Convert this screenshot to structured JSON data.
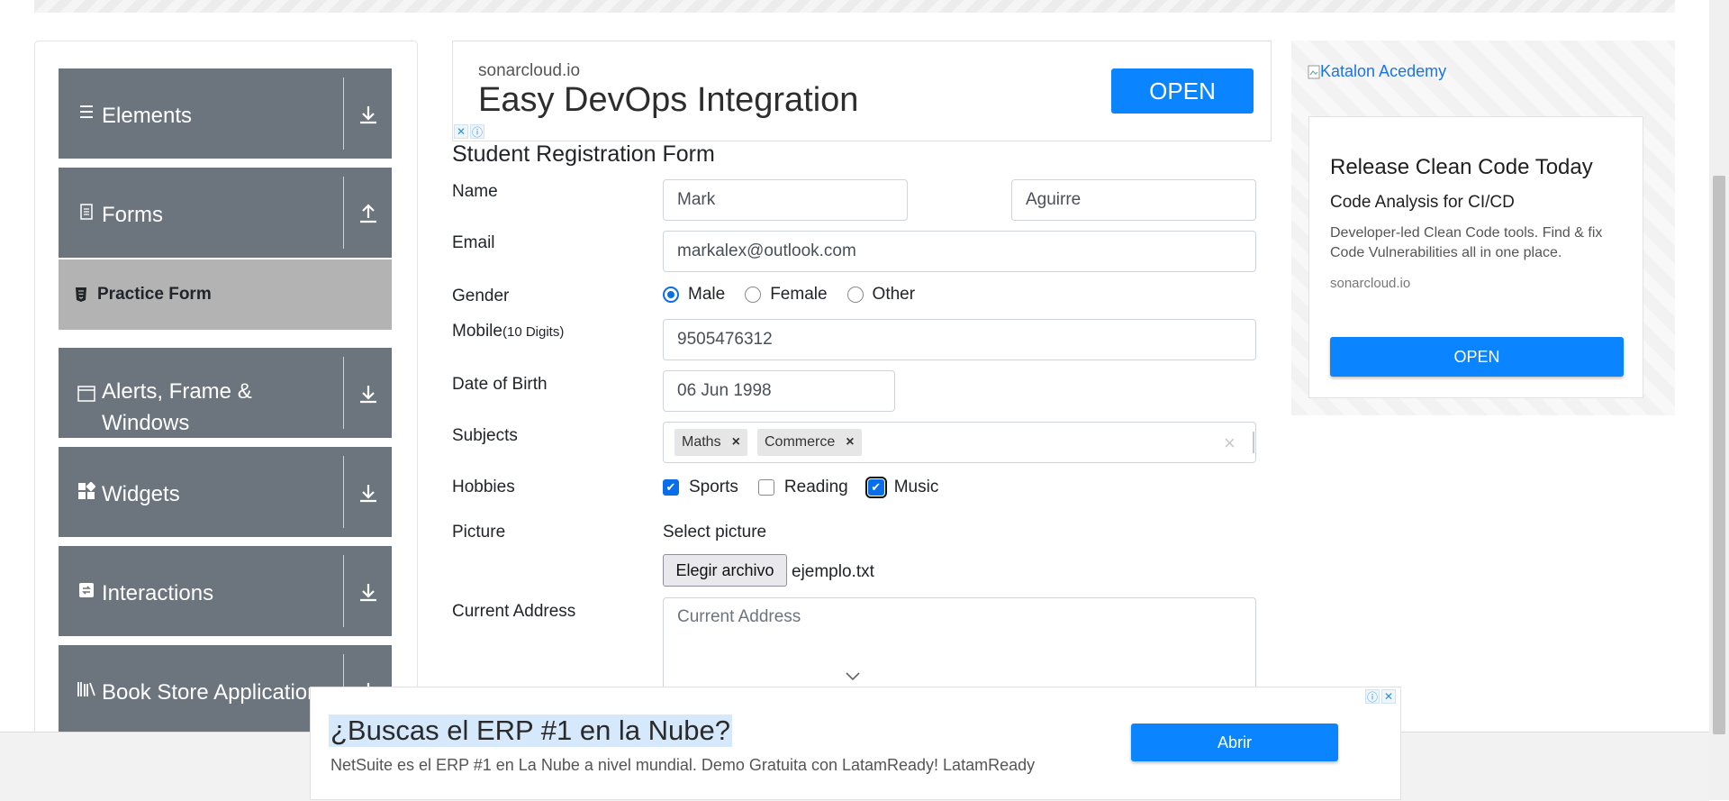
{
  "sidebar": {
    "groups": [
      {
        "label": "Elements",
        "icon": "menu-icon",
        "arrow": "down"
      },
      {
        "label": "Forms",
        "icon": "document-icon",
        "arrow": "up"
      },
      {
        "label": "Alerts, Frame &",
        "label_line2": "Windows",
        "icon": "window-icon",
        "arrow": "down"
      },
      {
        "label": "Widgets",
        "icon": "widgets-icon",
        "arrow": "down"
      },
      {
        "label": "Interactions",
        "icon": "interactions-icon",
        "arrow": "down"
      },
      {
        "label": "Book Store Application",
        "icon": "bookshelf-icon",
        "arrow": "down"
      }
    ],
    "active_item": "Practice Form"
  },
  "ad_top": {
    "source": "sonarcloud.io",
    "headline": "Easy DevOps Integration",
    "button": "OPEN"
  },
  "form": {
    "title": "Student Registration Form",
    "name_label": "Name",
    "first_name": "Mark",
    "last_name": "Aguirre",
    "email_label": "Email",
    "email": "markalex@outlook.com",
    "gender_label": "Gender",
    "gender_options": [
      "Male",
      "Female",
      "Other"
    ],
    "gender_selected": "Male",
    "mobile_label": "Mobile",
    "mobile_hint": "(10 Digits)",
    "mobile": "9505476312",
    "dob_label": "Date of Birth",
    "dob": "06 Jun 1998",
    "subjects_label": "Subjects",
    "subjects": [
      "Maths",
      "Commerce"
    ],
    "hobbies_label": "Hobbies",
    "hobbies": [
      {
        "label": "Sports",
        "checked": true
      },
      {
        "label": "Reading",
        "checked": false
      },
      {
        "label": "Music",
        "checked": true
      }
    ],
    "picture_label": "Picture",
    "select_picture": "Select picture",
    "file_button": "Elegir archivo",
    "file_name": "ejemplo.txt",
    "address_label": "Current Address",
    "address_placeholder": "Current Address"
  },
  "ad_right": {
    "image_alt": "Katalon Acedemy",
    "headline": "Release Clean Code Today",
    "subheadline": "Code Analysis for CI/CD",
    "description": "Developer-led Clean Code tools. Find & fix Code Vulnerabilities all in one place.",
    "domain": "sonarcloud.io",
    "button": "OPEN"
  },
  "ad_bottom": {
    "headline": "¿Buscas el ERP #1 en la Nube?",
    "description": "NetSuite es el ERP #1 en La Nube a nivel mundial. Demo Gratuita con LatamReady! LatamReady",
    "button": "Abrir"
  },
  "colors": {
    "sidebar_group": "#6c757d",
    "active_item": "#b3b3b3",
    "accent_blue": "#0a84ff",
    "checkbox_blue": "#0a6ee8"
  }
}
